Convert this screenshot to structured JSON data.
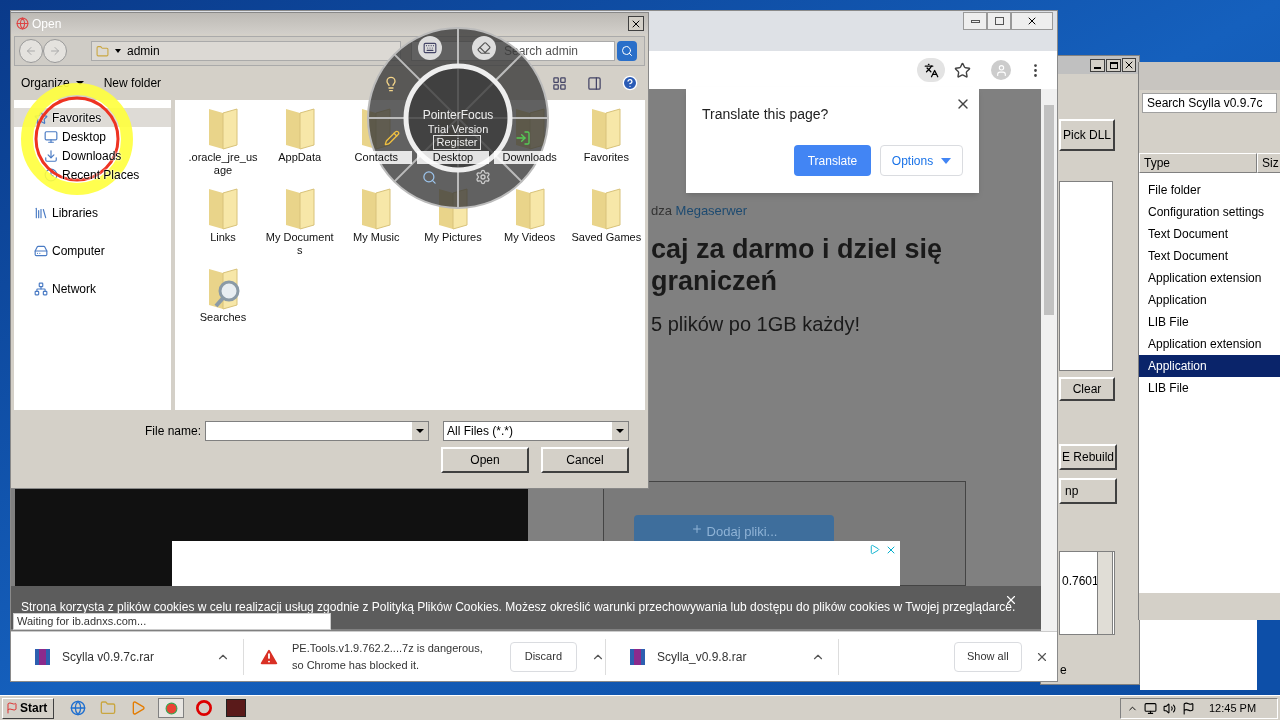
{
  "scylla_window": {
    "buttons": [
      {
        "label": "Pick DLL"
      },
      {
        "label": "Clear"
      },
      {
        "label": "E Rebuild"
      },
      {
        "label": "np"
      }
    ],
    "log_text": "0.7601",
    "status_text": "e"
  },
  "search_window": {
    "search_value": "Search Scylla v0.9.7c",
    "columns": [
      "Type",
      "Siz"
    ],
    "rows": [
      {
        "type": "File folder",
        "selected": false
      },
      {
        "type": "Configuration settings",
        "selected": false
      },
      {
        "type": "Text Document",
        "selected": false
      },
      {
        "type": "Text Document",
        "selected": false
      },
      {
        "type": "Application extension",
        "selected": false
      },
      {
        "type": "Application",
        "selected": false
      },
      {
        "type": "LIB File",
        "selected": false
      },
      {
        "type": "Application extension",
        "selected": false
      },
      {
        "type": "Application",
        "selected": true
      },
      {
        "type": "LIB File",
        "selected": false
      }
    ]
  },
  "browser": {
    "page": {
      "byline_prefix": "dza",
      "byline_link": "Megaserwer",
      "heading_lines": [
        "caj za darmo i dziel się",
        "graniczeń"
      ],
      "subheading": "5 plików po 1GB każdy!",
      "upload_button": "Dodaj pliki..."
    },
    "translate_popup": {
      "title": "Translate this page?",
      "translate_button": "Translate",
      "options_button": "Options"
    },
    "cookie_notice": "Strona korzysta z plików cookies w celu realizacji usług zgodnie z Polityką Plików Cookies. Możesz określić warunki przechowywania lub dostępu do plików cookies w Twojej przeglądarce.",
    "status": "Waiting for ib.adnxs.com...",
    "downloads": [
      {
        "kind": "file",
        "name": "Scylla v0.9.7c.rar"
      },
      {
        "kind": "blocked",
        "name": "PE.Tools.v1.9.762.2....7z is dangerous, so Chrome has blocked it.",
        "action": "Discard"
      },
      {
        "kind": "file",
        "name": "Scylla_v0.9.8.rar"
      }
    ],
    "show_all": "Show all"
  },
  "open_dialog": {
    "title": "Open",
    "location": "admin",
    "search_placeholder": "Search admin",
    "toolbar": [
      "Organize",
      "New folder"
    ],
    "nav": [
      {
        "label": "Favorites",
        "kind": "star",
        "selected": true
      },
      {
        "label": "Desktop",
        "kind": "desktop",
        "selected": false
      },
      {
        "label": "Downloads",
        "kind": "downloads",
        "selected": false
      },
      {
        "label": "Recent Places",
        "kind": "recent",
        "selected": false
      },
      {
        "label": "Libraries",
        "kind": "libraries",
        "selected": false
      },
      {
        "label": "Computer",
        "kind": "computer",
        "selected": false
      },
      {
        "label": "Network",
        "kind": "network",
        "selected": false
      }
    ],
    "items": [
      {
        "label": ".oracle_jre_usage",
        "kind": "folder"
      },
      {
        "label": "AppData",
        "kind": "folder"
      },
      {
        "label": "Contacts",
        "kind": "folder"
      },
      {
        "label": "Desktop",
        "kind": "folder"
      },
      {
        "label": "Downloads",
        "kind": "folder"
      },
      {
        "label": "Favorites",
        "kind": "folder"
      },
      {
        "label": "Links",
        "kind": "folder"
      },
      {
        "label": "My Documents",
        "kind": "folder"
      },
      {
        "label": "My Music",
        "kind": "folder"
      },
      {
        "label": "My Pictures",
        "kind": "folder"
      },
      {
        "label": "My Videos",
        "kind": "folder"
      },
      {
        "label": "Saved Games",
        "kind": "folder"
      },
      {
        "label": "Searches",
        "kind": "search"
      }
    ],
    "file_name_label": "File name:",
    "file_type": "All Files (*.*)",
    "buttons": [
      "Open",
      "Cancel"
    ]
  },
  "pointer_focus": {
    "title": "PointerFocus",
    "subtitle": "Trial Version",
    "register": "Register"
  },
  "taskbar": {
    "start": "Start",
    "clock": "12:45 PM"
  }
}
